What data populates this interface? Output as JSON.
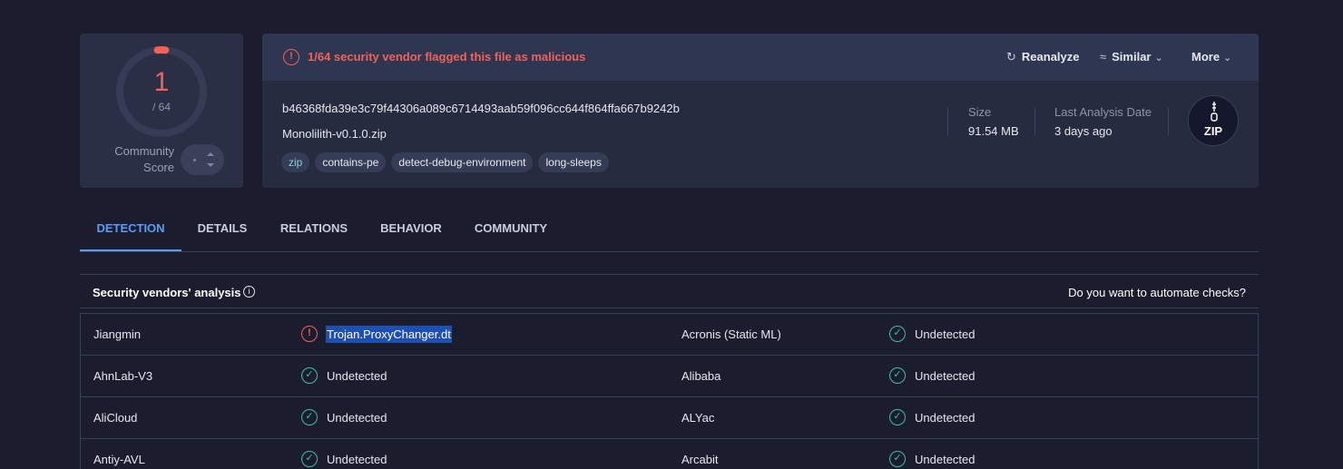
{
  "score": {
    "detections": "1",
    "total": "/ 64",
    "community_label_line1": "Community",
    "community_label_line2": "Score",
    "detection_fraction": 0.0156
  },
  "alert": {
    "icon": "alert-circle-icon",
    "text": "1/64 security vendor flagged this file as malicious",
    "color": "#f0625a"
  },
  "actions": {
    "reanalyze": "Reanalyze",
    "similar": "Similar",
    "more": "More"
  },
  "file": {
    "hash": "b46368fda39e3c79f44306a089c6714493aab59f096cc644f864ffa667b9242b",
    "name": "Monolilith-v0.1.0.zip",
    "tags": [
      "zip",
      "contains-pe",
      "detect-debug-environment",
      "long-sleeps"
    ],
    "size_label": "Size",
    "size_value": "91.54 MB",
    "date_label": "Last Analysis Date",
    "date_value": "3 days ago",
    "type_badge": "ZIP"
  },
  "tabs": [
    {
      "label": "DETECTION",
      "active": true
    },
    {
      "label": "DETAILS",
      "active": false
    },
    {
      "label": "RELATIONS",
      "active": false
    },
    {
      "label": "BEHAVIOR",
      "active": false
    },
    {
      "label": "COMMUNITY",
      "active": false
    }
  ],
  "vendors_panel": {
    "title": "Security vendors' analysis",
    "automate": "Do you want to automate checks?"
  },
  "vendors": [
    [
      {
        "name": "Jiangmin",
        "result": "Trojan.ProxyChanger.dt",
        "malicious": true,
        "selected": true
      },
      {
        "name": "Acronis (Static ML)",
        "result": "Undetected",
        "malicious": false
      }
    ],
    [
      {
        "name": "AhnLab-V3",
        "result": "Undetected",
        "malicious": false
      },
      {
        "name": "Alibaba",
        "result": "Undetected",
        "malicious": false
      }
    ],
    [
      {
        "name": "AliCloud",
        "result": "Undetected",
        "malicious": false
      },
      {
        "name": "ALYac",
        "result": "Undetected",
        "malicious": false
      }
    ],
    [
      {
        "name": "Antiy-AVL",
        "result": "Undetected",
        "malicious": false
      },
      {
        "name": "Arcabit",
        "result": "Undetected",
        "malicious": false
      }
    ]
  ],
  "colors": {
    "malicious": "#f0625a",
    "clean": "#3dbfa2",
    "accent": "#5c9cf5"
  }
}
